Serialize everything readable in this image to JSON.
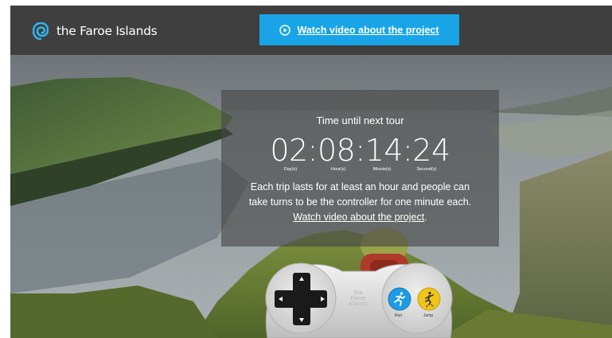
{
  "header": {
    "logo_text": "the Faroe Islands",
    "video_button_label": "Watch video about the project"
  },
  "countdown": {
    "title": "Time until next tour",
    "time": "02:08:14:24",
    "units": [
      "Day(s)",
      "Hour(s)",
      "Minute(s)",
      "Second(s)"
    ],
    "description_line1": "Each trip lasts for at least an hour and people can",
    "description_line2": "take turns to be the controller for one minute each.",
    "link_text": "Watch video about the project",
    "link_suffix": "."
  },
  "controller": {
    "brand_line1": "the",
    "brand_line2": "Faroe",
    "brand_line3": "Islands",
    "run_label": "Run",
    "jump_label": "Jump"
  },
  "colors": {
    "header_bg": "#3f3f3f",
    "button_bg": "#19a4e8",
    "logo_icon": "#2fb5ec",
    "run_button": "#1e9be6",
    "jump_button": "#f0c419"
  }
}
